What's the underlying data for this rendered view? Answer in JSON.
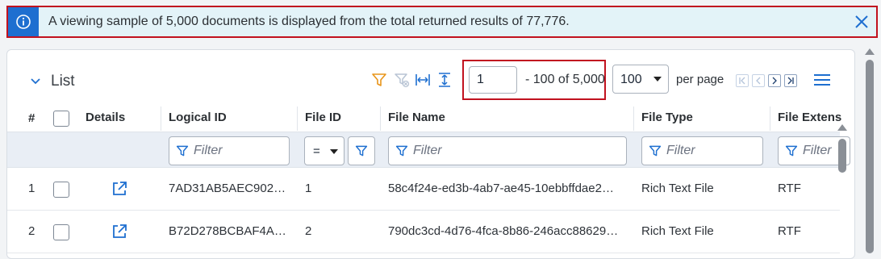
{
  "banner": {
    "message": "A viewing sample of 5,000 documents is displayed from the total returned results of 77,776.",
    "icon": "info-icon",
    "close_icon": "close-icon",
    "bg_color": "#e3f3f8",
    "accent_color": "#1e6fd0",
    "highlight_color": "#c1121f"
  },
  "list": {
    "title": "List",
    "toolbar_icons": [
      "filter-icon",
      "clear-filter-icon",
      "fit-width-icon",
      "fit-height-icon"
    ],
    "pagination": {
      "page_value": "1",
      "range_text": "- 100 of 5,000",
      "per_page_value": "100",
      "per_page_label": "per page",
      "pager_icons": [
        "first-page-icon",
        "previous-page-icon",
        "next-page-icon",
        "last-page-icon"
      ]
    },
    "columns": [
      "#",
      "Details",
      "Logical ID",
      "File ID",
      "File Name",
      "File Type",
      "File Extens"
    ],
    "filters": {
      "placeholder": "Filter",
      "file_id_operator": "="
    },
    "rows": [
      {
        "num": "1",
        "logical_id": "7AD31AB5AEC902…",
        "file_id": "1",
        "file_name": "58c4f24e-ed3b-4ab7-ae45-10ebbffdae2…",
        "file_type": "Rich Text File",
        "file_ext": "RTF"
      },
      {
        "num": "2",
        "logical_id": "B72D278BCBAF4A…",
        "file_id": "2",
        "file_name": "790dc3cd-4d76-4fca-8b86-246acc88629…",
        "file_type": "Rich Text File",
        "file_ext": "RTF"
      }
    ]
  }
}
